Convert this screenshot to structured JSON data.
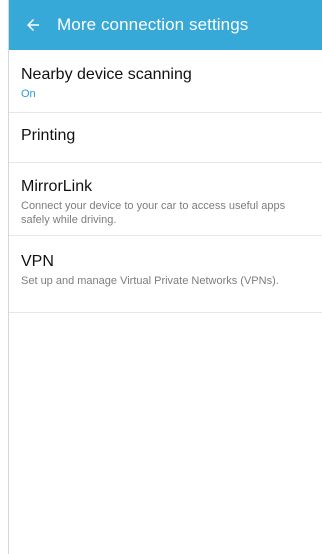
{
  "appbar": {
    "title": "More connection settings",
    "back_icon": "arrow-left-icon",
    "color": "#37a9d9"
  },
  "items": [
    {
      "title": "Nearby device scanning",
      "status": "On"
    },
    {
      "title": "Printing"
    },
    {
      "title": "MirrorLink",
      "description": "Connect your device to your car to access useful apps safely while driving."
    },
    {
      "title": "VPN",
      "description": "Set up and manage Virtual Private Networks (VPNs)."
    }
  ],
  "colors": {
    "status_accent": "#2a9bd6",
    "title_text": "#111111",
    "secondary_text": "#7d7d7d"
  }
}
